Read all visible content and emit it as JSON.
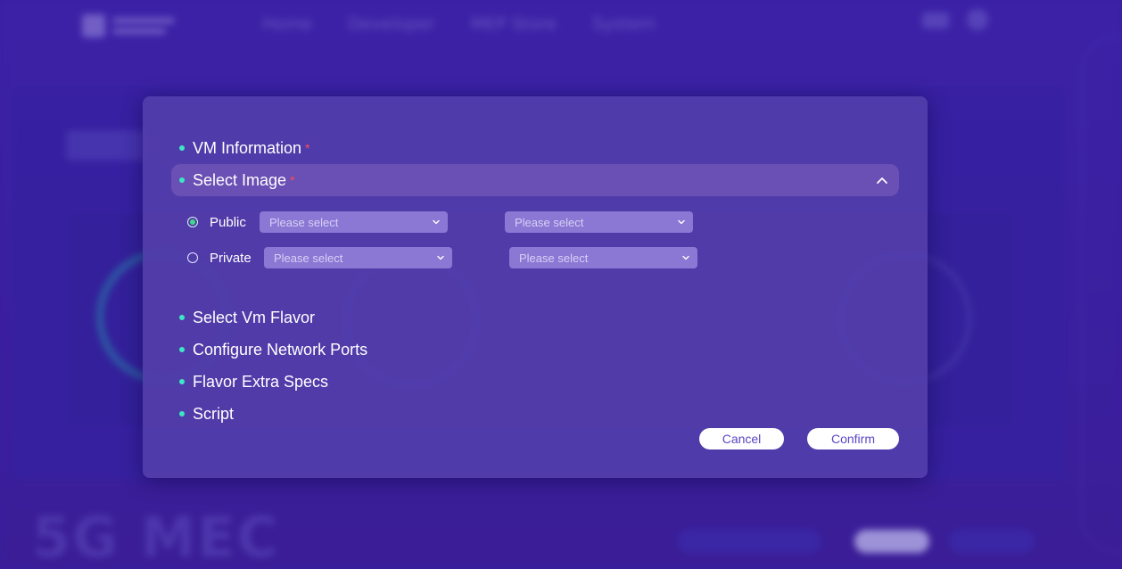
{
  "background": {
    "nav": [
      "Home",
      "Developer",
      "MEP Store",
      "System"
    ],
    "bottom_text": "5G MEC"
  },
  "dialog": {
    "sections": [
      {
        "label": "VM Information",
        "required": "*"
      },
      {
        "label": "Select Image",
        "required": "*"
      },
      {
        "label": "Select Vm Flavor"
      },
      {
        "label": "Configure Network Ports"
      },
      {
        "label": "Flavor Extra Specs"
      },
      {
        "label": "Script"
      }
    ],
    "image": {
      "public_label": "Public",
      "private_label": "Private",
      "selected": "Public",
      "placeholder": "Please select"
    },
    "cancel_label": "Cancel",
    "confirm_label": "Confirm"
  },
  "colors": {
    "accent_dot": "#3ee6c4",
    "required": "#ff4b5c",
    "dialog_bg": "#523eaa",
    "active_row": "#6a4fb4",
    "select_bg": "#8a78d4",
    "button_text": "#5a46c4"
  },
  "icons": {
    "collapse": "chevron-up-icon",
    "dropdown": "chevron-down-icon"
  }
}
